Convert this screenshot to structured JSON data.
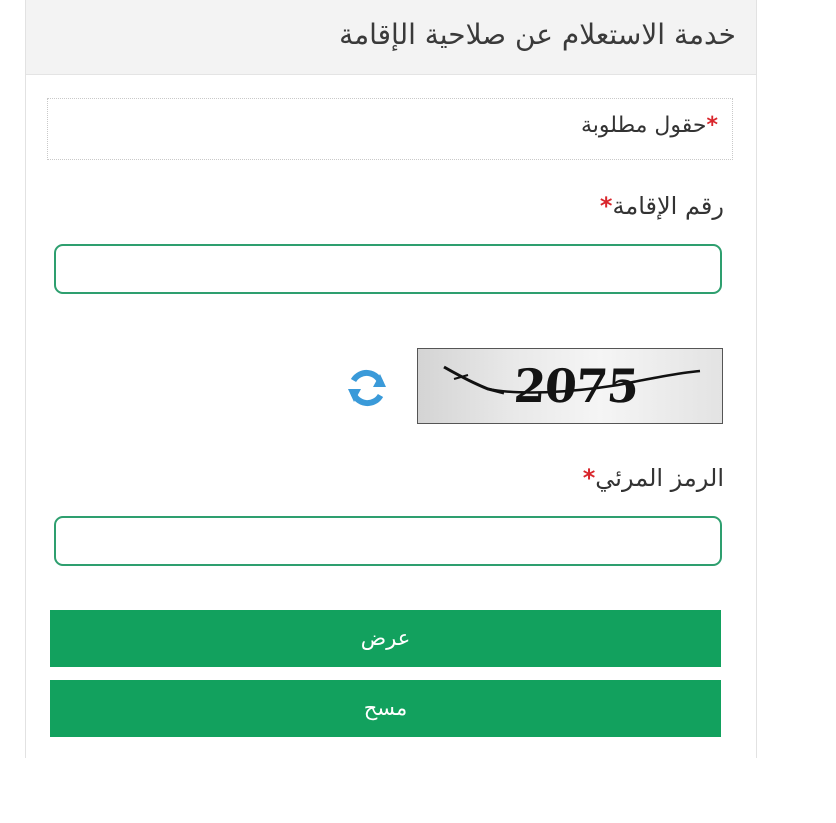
{
  "header": {
    "title": "خدمة الاستعلام عن صلاحية الإقامة"
  },
  "notice": {
    "required_star": "*",
    "required_text": "حقول مطلوبة"
  },
  "form": {
    "residence_number": {
      "label": "رقم الإقامة",
      "required_star": "*",
      "value": ""
    },
    "captcha": {
      "image_text": "2075",
      "refresh_icon": "refresh-icon",
      "label": "الرمز المرئي",
      "required_star": "*",
      "value": ""
    },
    "buttons": {
      "submit_label": "عرض",
      "clear_label": "مسح"
    }
  },
  "colors": {
    "accent": "#12a15e",
    "input_border": "#2e9f6f",
    "required_star": "#d9262c",
    "refresh_icon": "#3a9ad9"
  }
}
